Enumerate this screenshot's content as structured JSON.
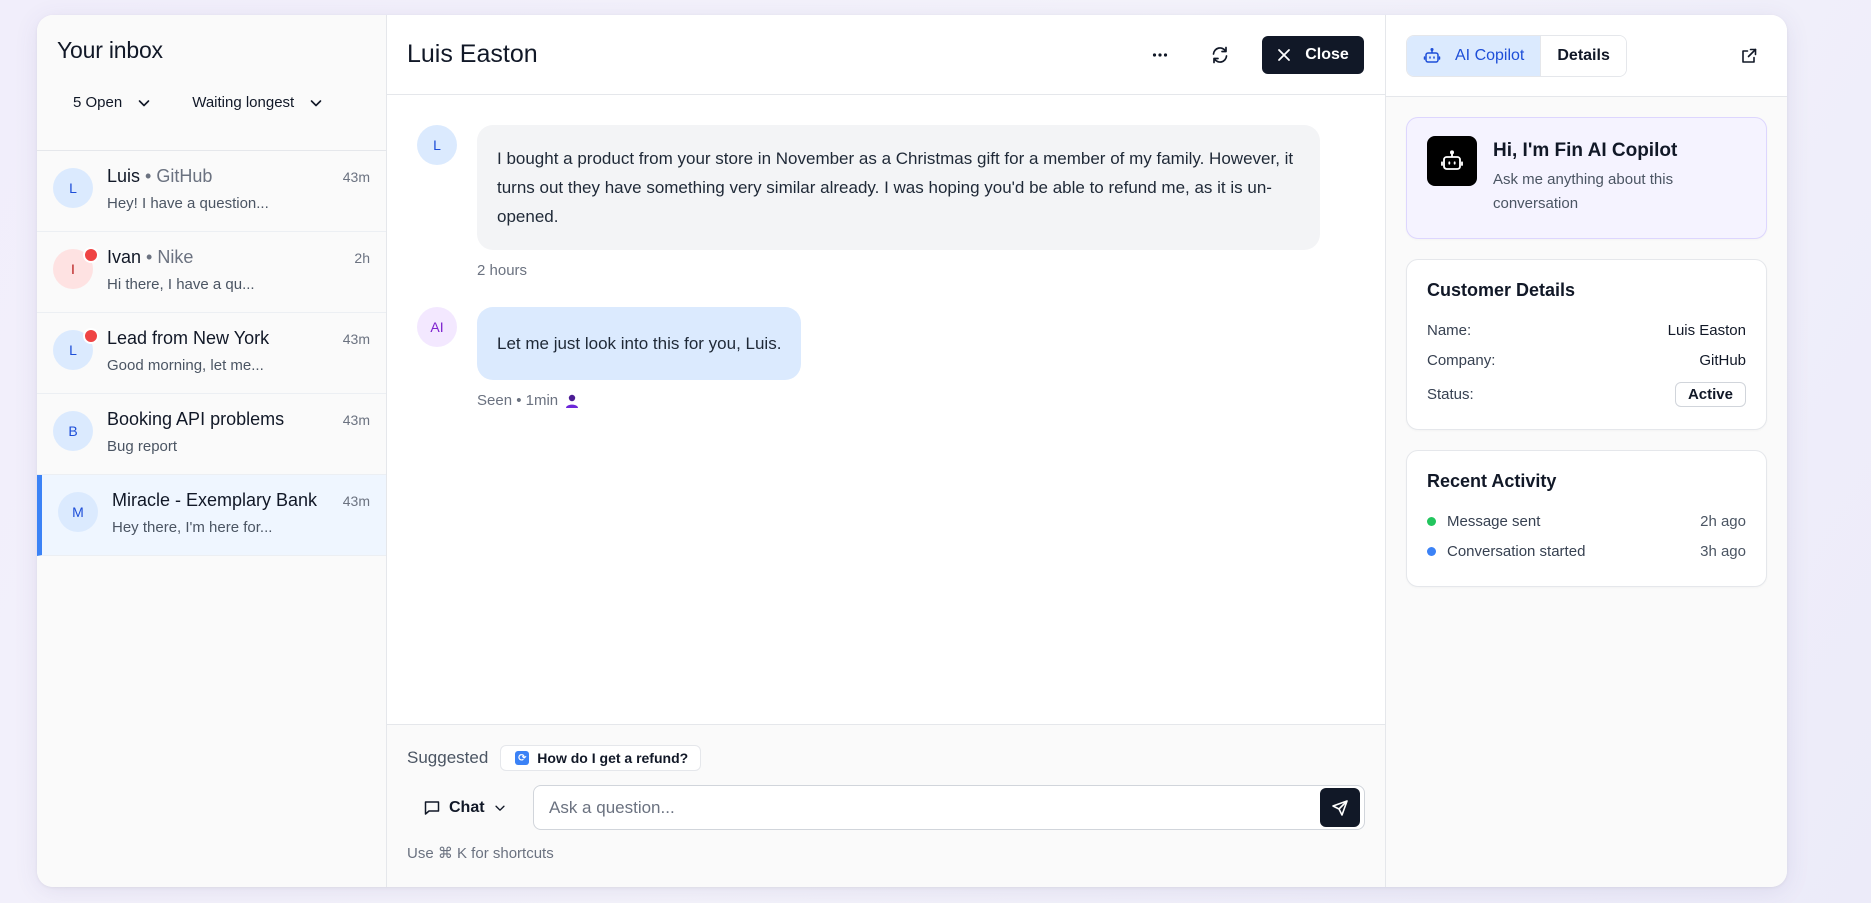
{
  "sidebar": {
    "title": "Your inbox",
    "filter_status": "5 Open",
    "filter_sort": "Waiting longest",
    "conversations": [
      {
        "initial": "L",
        "name": "Luis",
        "company": " • GitHub",
        "time": "43m",
        "preview": "Hey! I have a question...",
        "unread": false
      },
      {
        "initial": "I",
        "name": "Ivan",
        "company": " • Nike",
        "time": "2h",
        "preview": "Hi there, I have a qu...",
        "unread": true
      },
      {
        "initial": "L",
        "name": "Lead from New York",
        "company": "",
        "time": "43m",
        "preview": "Good morning, let me...",
        "unread": true
      },
      {
        "initial": "B",
        "name": "Booking API problems",
        "company": "",
        "time": "43m",
        "preview": "Bug report",
        "unread": false
      },
      {
        "initial": "M",
        "name": "Miracle - Exemplary Bank",
        "company": "",
        "time": "43m",
        "preview": "Hey there, I'm here for...",
        "unread": false
      }
    ]
  },
  "main": {
    "title": "Luis Easton",
    "close_label": "Close",
    "messages": [
      {
        "avatar": "L",
        "text": "I bought a product from your store in November as a Christmas gift for a member of my family. However, it turns out they have something very similar already. I was hoping you'd be able to refund me, as it is un-opened.",
        "meta": "2 hours"
      },
      {
        "avatar": "AI",
        "text": "Let me just look into this for you, Luis.",
        "meta": "Seen • 1min"
      }
    ],
    "suggested_label": "Suggested",
    "suggested_chip": "How do I get a refund?",
    "channel": "Chat",
    "input_placeholder": "Ask a question...",
    "hint": "Use ⌘ K for shortcuts"
  },
  "right": {
    "tab_active": "AI Copilot",
    "tab_inactive": "Details",
    "copilot_title": "Hi, I'm Fin AI Copilot",
    "copilot_sub": "Ask me anything about this conversation",
    "customer": {
      "title": "Customer Details",
      "name_label": "Name:",
      "name": "Luis Easton",
      "company_label": "Company:",
      "company": "GitHub",
      "status_label": "Status:",
      "status": "Active"
    },
    "activity": {
      "title": "Recent Activity",
      "items": [
        {
          "label": "Message sent",
          "time": "2h ago",
          "color": "#22c55e"
        },
        {
          "label": "Conversation started",
          "time": "3h ago",
          "color": "#3b82f6"
        }
      ]
    }
  },
  "colors": {
    "accent": "#3b82f6",
    "dark": "#111827",
    "unread": "#ef4444"
  }
}
